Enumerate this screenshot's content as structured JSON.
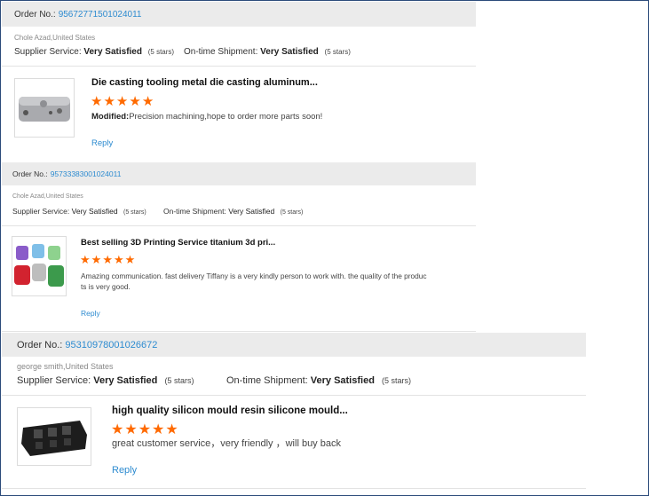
{
  "colors": {
    "accent": "#2d8bd0",
    "star": "#ff6a00",
    "header_bg": "#ebebeb"
  },
  "orders": [
    {
      "order_label": "Order No.:",
      "order_number": "95672771501024011",
      "buyer": "Chole Azad,United States",
      "supplier_label": "Supplier Service:",
      "supplier_value": "Very Satisfied",
      "supplier_stars": "(5 stars)",
      "shipment_label": "On-time Shipment:",
      "shipment_value": "Very Satisfied",
      "shipment_stars": "(5 stars)",
      "product_title": "Die casting tooling metal die casting aluminum...",
      "rating": 5,
      "review_prefix": "Modified:",
      "review": "Precision machining,hope to order more parts soon!",
      "reply_label": "Reply",
      "thumbnail": "die-cast-aluminum-part-image"
    },
    {
      "order_label": "Order No.:",
      "order_number": "95733383001024011",
      "buyer": "Chole Azad,United States",
      "supplier_label": "Supplier Service:",
      "supplier_value": "Very Satisfied",
      "supplier_stars": "(5 stars)",
      "shipment_label": "On-time Shipment:",
      "shipment_value": "Very Satisfied",
      "shipment_stars": "(5 stars)",
      "product_title": "Best selling 3D Printing Service titanium 3d pri...",
      "rating": 5,
      "review_prefix": "",
      "review_line1": "Amazing communication. fast delivery Tiffany is a very kindly person to work with. the quality of the produc",
      "review_line2": "ts is very good.",
      "reply_label": "Reply",
      "thumbnail": "3d-printed-cups-image"
    },
    {
      "order_label": "Order No.:",
      "order_number": "95310978001026672",
      "buyer": "george smith,United States",
      "supplier_label": "Supplier Service:",
      "supplier_value": "Very Satisfied",
      "supplier_stars": "(5 stars)",
      "shipment_label": "On-time Shipment:",
      "shipment_value": "Very Satisfied",
      "shipment_stars": "(5 stars)",
      "product_title": "high quality silicon mould resin silicone mould...",
      "rating": 5,
      "review_prefix": "",
      "review": "great customer service，very friendly ，will buy back",
      "reply_label": "Reply",
      "thumbnail": "black-silicone-mould-image"
    }
  ]
}
